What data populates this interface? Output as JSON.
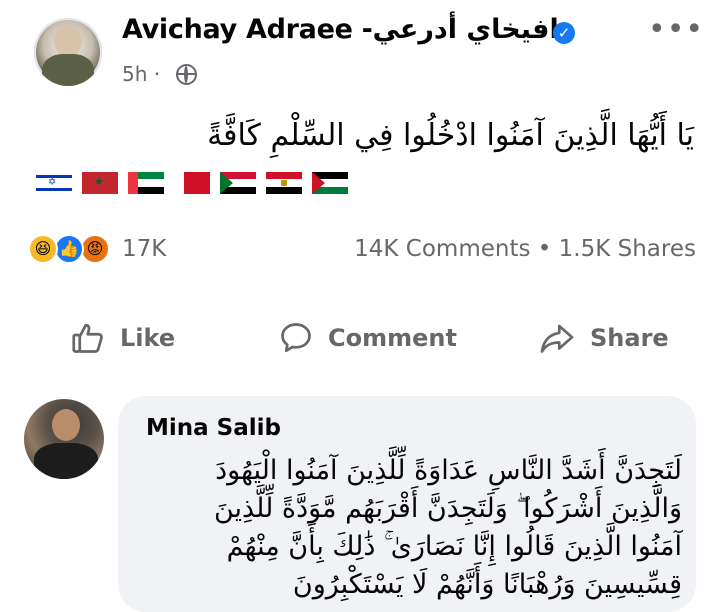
{
  "post": {
    "author": "Avichay Adraee -افيخاي أدرعي",
    "verified_mark": "✓",
    "more_label": "•••",
    "time": "5h ·",
    "text": "يَا أَيُّهَا الَّذِينَ آمَنُوا ادْخُلُوا فِي السِّلْمِ كَافَّةً",
    "flags": [
      "israel-flag",
      "morocco-flag",
      "uae-flag",
      "bahrain-flag",
      "sudan-flag",
      "egypt-flag",
      "palestine-flag"
    ]
  },
  "reactions": {
    "icons": [
      "haha-icon",
      "like-icon",
      "angry-icon"
    ],
    "count": "17K",
    "stats": "14K Comments • 1.5K Shares"
  },
  "actions": {
    "like": "Like",
    "comment": "Comment",
    "share": "Share"
  },
  "comment": {
    "author": "Mina Salib",
    "lines": [
      "لَتَجِدَنَّ أَشَدَّ النَّاسِ عَدَاوَةً لِّلَّذِينَ آمَنُوا الْيَهُودَ",
      "وَالَّذِينَ أَشْرَكُوا ۖ وَلَتَجِدَنَّ أَقْرَبَهُم مَّوَدَّةً لِّلَّذِينَ",
      "آمَنُوا الَّذِينَ قَالُوا إِنَّا نَصَارَىٰ ۚ ذَٰلِكَ بِأَنَّ مِنْهُمْ",
      "قِسِّيسِينَ وَرُهْبَانًا وَأَنَّهُمْ لَا يَسْتَكْبِرُونَ"
    ]
  },
  "colors": {
    "facebook_blue": "#1877f2",
    "secondary_text": "#65676b",
    "bubble": "#f0f2f5"
  }
}
